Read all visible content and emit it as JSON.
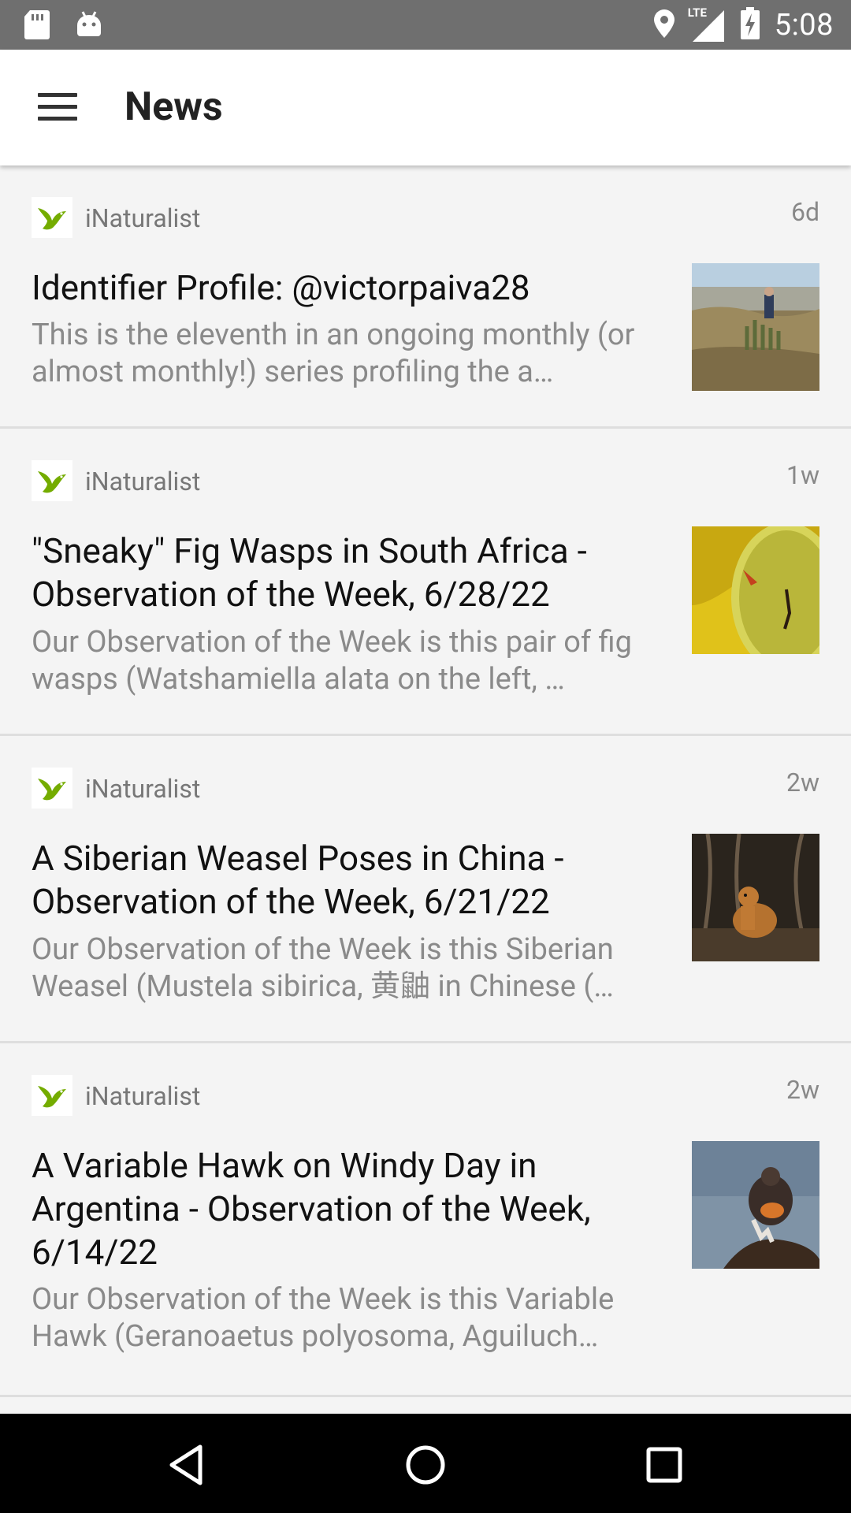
{
  "status_bar": {
    "time": "5:08",
    "network_label": "LTE",
    "left_icons": [
      "sd-card-icon",
      "android-icon"
    ],
    "right_icons": [
      "location-icon",
      "lte-signal-icon",
      "battery-charging-icon"
    ]
  },
  "app_bar": {
    "title": "News",
    "menu_icon": "hamburger-menu-icon"
  },
  "feed": {
    "items": [
      {
        "source": "iNaturalist",
        "age": "6d",
        "title": "Identifier Profile: @victorpaiva28",
        "excerpt": "This is the eleventh in an ongoing monthly (or almost monthly!) series profiling the a…"
      },
      {
        "source": "iNaturalist",
        "age": "1w",
        "title": "\"Sneaky\" Fig Wasps in South Africa - Observation of the Week, 6/28/22",
        "excerpt": "Our Observation of the Week is this pair of fig wasps (Watshamiella alata on the left, …"
      },
      {
        "source": "iNaturalist",
        "age": "2w",
        "title": "A Siberian Weasel Poses in China - Observation of the Week, 6/21/22",
        "excerpt": "Our Observation of the Week is this Siberian Weasel (Mustela sibirica, 黄鼬 in Chinese (…"
      },
      {
        "source": "iNaturalist",
        "age": "2w",
        "title": "A Variable Hawk on Windy Day in Argentina - Observation of the Week, 6/14/22",
        "excerpt": "Our Observation of the Week is this Variable Hawk (Geranoaetus polyosoma, Aguiluch…"
      }
    ]
  },
  "nav_bar": {
    "icons": [
      "back-icon",
      "home-icon",
      "recents-icon"
    ]
  },
  "colors": {
    "status_bar": "#6f6f6f",
    "app_bar": "#ffffff",
    "background": "#f4f4f4",
    "brand_green": "#74ac00",
    "nav_bar": "#000000"
  }
}
